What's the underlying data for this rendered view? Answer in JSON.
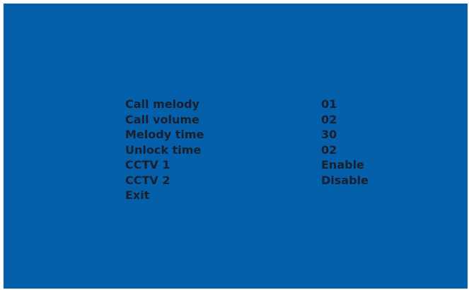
{
  "menu": {
    "items": [
      {
        "label": "Call melody",
        "value": "01"
      },
      {
        "label": "Call volume",
        "value": "02"
      },
      {
        "label": "Melody time",
        "value": "30"
      },
      {
        "label": "Unlock time",
        "value": "02"
      },
      {
        "label": "CCTV 1",
        "value": "Enable"
      },
      {
        "label": "CCTV 2",
        "value": "Disable"
      },
      {
        "label": "Exit",
        "value": ""
      }
    ]
  },
  "colors": {
    "background": "#0460ab",
    "text": "#1a1f2e"
  }
}
